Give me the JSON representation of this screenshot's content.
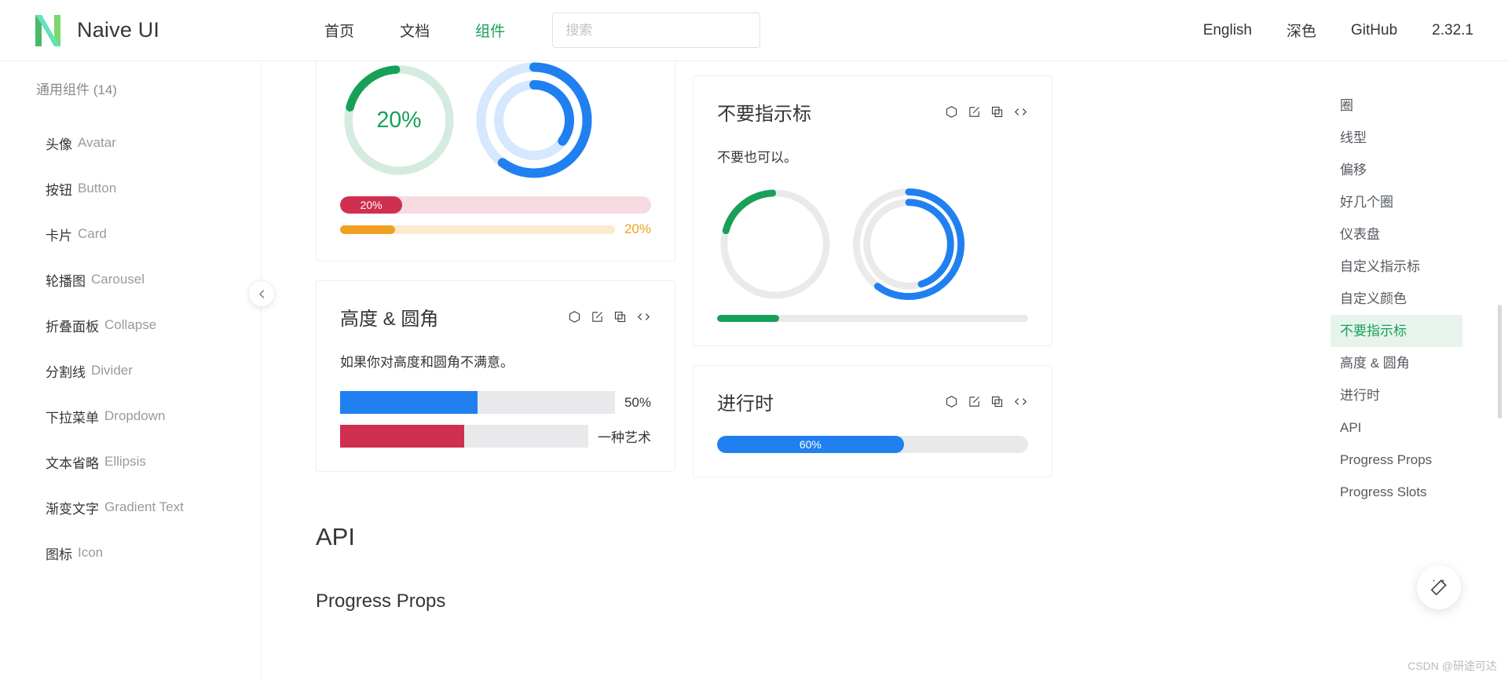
{
  "header": {
    "brand": "Naive UI",
    "logo_icon": "naive-n-logo",
    "nav": [
      {
        "label": "首页",
        "active": false
      },
      {
        "label": "文档",
        "active": false
      },
      {
        "label": "组件",
        "active": true
      }
    ],
    "search": {
      "placeholder": "搜索",
      "value": "",
      "icon": "search-icon"
    },
    "right": [
      {
        "label": "English"
      },
      {
        "label": "深色"
      },
      {
        "label": "GitHub"
      },
      {
        "label": "2.32.1"
      }
    ]
  },
  "sidebar": {
    "group_title": "通用组件 (14)",
    "items": [
      {
        "cn": "头像",
        "en": "Avatar"
      },
      {
        "cn": "按钮",
        "en": "Button"
      },
      {
        "cn": "卡片",
        "en": "Card"
      },
      {
        "cn": "轮播图",
        "en": "Carousel"
      },
      {
        "cn": "折叠面板",
        "en": "Collapse"
      },
      {
        "cn": "分割线",
        "en": "Divider"
      },
      {
        "cn": "下拉菜单",
        "en": "Dropdown"
      },
      {
        "cn": "文本省略",
        "en": "Ellipsis"
      },
      {
        "cn": "渐变文字",
        "en": "Gradient Text"
      },
      {
        "cn": "图标",
        "en": "Icon"
      }
    ],
    "collapse_icon": "chevron-left-icon"
  },
  "main": {
    "card_icons": [
      "cube-icon",
      "edit-icon",
      "copy-icon",
      "code-icon"
    ],
    "custom_color_card": {
      "ring_green": {
        "percent": 20,
        "label": "20%",
        "color": "#18a058",
        "rail": "#d5ebe0"
      },
      "ring_blue_outer": {
        "percent": 60,
        "color": "#2080f0",
        "rail": "#d6e8fd"
      },
      "ring_blue_inner": {
        "percent": 35,
        "color": "#2080f0",
        "rail": "#d6e8fd"
      },
      "bar_red": {
        "percent": 20,
        "label": "20%",
        "color": "#d03050",
        "rail": "#f7dbe1"
      },
      "bar_orange": {
        "percent": 20,
        "label": "20%",
        "color": "#f0a020",
        "rail": "#fbeacf"
      }
    },
    "no_indicator_card": {
      "title": "不要指示标",
      "desc": "不要也可以。",
      "ring_green": {
        "percent": 20,
        "color": "#18a058",
        "rail": "#eaeaec"
      },
      "ring_blue_outer": {
        "percent": 60,
        "color": "#2080f0",
        "rail": "#eaeaec"
      },
      "ring_blue_inner": {
        "percent": 45,
        "color": "#2080f0",
        "rail": "#eaeaec"
      },
      "bar": {
        "percent": 20,
        "color": "#18a058",
        "rail": "#e9e9ec"
      }
    },
    "height_radius_card": {
      "title": "高度 & 圆角",
      "desc": "如果你对高度和圆角不满意。",
      "bar_blue": {
        "percent": 50,
        "label": "50%",
        "color": "#2080f0",
        "rail": "#e9e9ec"
      },
      "bar_red": {
        "percent": 50,
        "label": "一种艺术",
        "color": "#d03050",
        "rail": "#e9e9ec"
      }
    },
    "processing_card": {
      "title": "进行时",
      "bar": {
        "percent": 60,
        "label": "60%",
        "color": "#2080f0",
        "rail": "#e9e9ec"
      }
    },
    "api_heading": "API",
    "api_subheading": "Progress Props"
  },
  "toc": {
    "items": [
      {
        "label": "圈",
        "active": false
      },
      {
        "label": "线型",
        "active": false
      },
      {
        "label": "偏移",
        "active": false
      },
      {
        "label": "好几个圈",
        "active": false
      },
      {
        "label": "仪表盘",
        "active": false
      },
      {
        "label": "自定义指示标",
        "active": false
      },
      {
        "label": "自定义颜色",
        "active": false
      },
      {
        "label": "不要指示标",
        "active": true
      },
      {
        "label": "高度 & 圆角",
        "active": false
      },
      {
        "label": "进行时",
        "active": false
      },
      {
        "label": "API",
        "active": false
      },
      {
        "label": "Progress Props",
        "active": false
      },
      {
        "label": "Progress Slots",
        "active": false
      }
    ]
  },
  "fab": {
    "icon": "magic-wand-icon"
  },
  "watermark": "CSDN @研途可达"
}
